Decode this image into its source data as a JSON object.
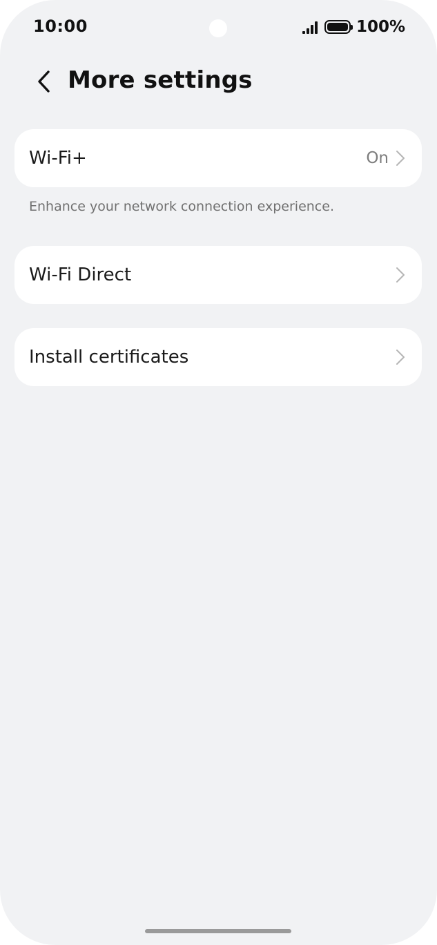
{
  "status_bar": {
    "time": "10:00",
    "battery_text": "100%",
    "icons": [
      "signal-icon",
      "battery-icon"
    ]
  },
  "header": {
    "back_icon": "chevron-left-icon",
    "title": "More settings"
  },
  "items": [
    {
      "label": "Wi-Fi+",
      "value": "On",
      "description": "Enhance your network connection experience.",
      "icon": "chevron-right-icon"
    },
    {
      "label": "Wi-Fi Direct",
      "value": "",
      "icon": "chevron-right-icon"
    },
    {
      "label": "Install certificates",
      "value": "",
      "icon": "chevron-right-icon"
    }
  ],
  "colors": {
    "background": "#f1f2f4",
    "card": "#ffffff",
    "text_primary": "#1a1a1a",
    "text_secondary": "#7d7d7d"
  }
}
